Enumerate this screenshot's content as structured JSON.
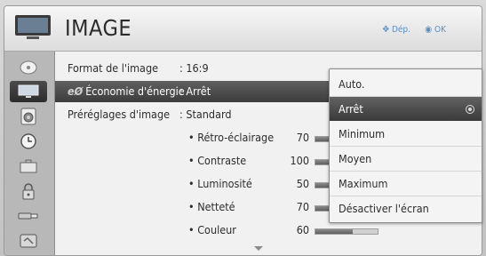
{
  "header": {
    "title": "IMAGE",
    "nav_hint": "Dép.",
    "ok_hint": "OK"
  },
  "sidebar": {
    "items": [
      {
        "icon": "satellite-dish-icon"
      },
      {
        "icon": "tv-screen-icon",
        "active": true
      },
      {
        "icon": "speaker-icon"
      },
      {
        "icon": "clock-icon"
      },
      {
        "icon": "briefcase-icon"
      },
      {
        "icon": "lock-icon"
      },
      {
        "icon": "usb-icon"
      },
      {
        "icon": "support-icon"
      }
    ]
  },
  "menu": {
    "rows": [
      {
        "label": "Format de l'image",
        "value": ": 16:9"
      },
      {
        "label": "Économie d'énergie",
        "value": ": Arrêt",
        "prefix_icon": "eco-icon"
      },
      {
        "label": "Préréglages d'image",
        "value": ": Standard"
      }
    ],
    "settings": [
      {
        "label": "• Rétro-éclairage",
        "value": "70",
        "level": 0.7
      },
      {
        "label": "• Contraste",
        "value": "100",
        "level": 1.0
      },
      {
        "label": "• Luminosité",
        "value": "50",
        "level": 0.5
      },
      {
        "label": "• Netteté",
        "value": "70",
        "level": 0.7
      },
      {
        "label": "• Couleur",
        "value": "60",
        "level": 0.6
      }
    ]
  },
  "dropdown": {
    "options": [
      "Auto.",
      "Arrêt",
      "Minimum",
      "Moyen",
      "Maximum",
      "Désactiver l'écran"
    ],
    "selected_index": 1
  }
}
